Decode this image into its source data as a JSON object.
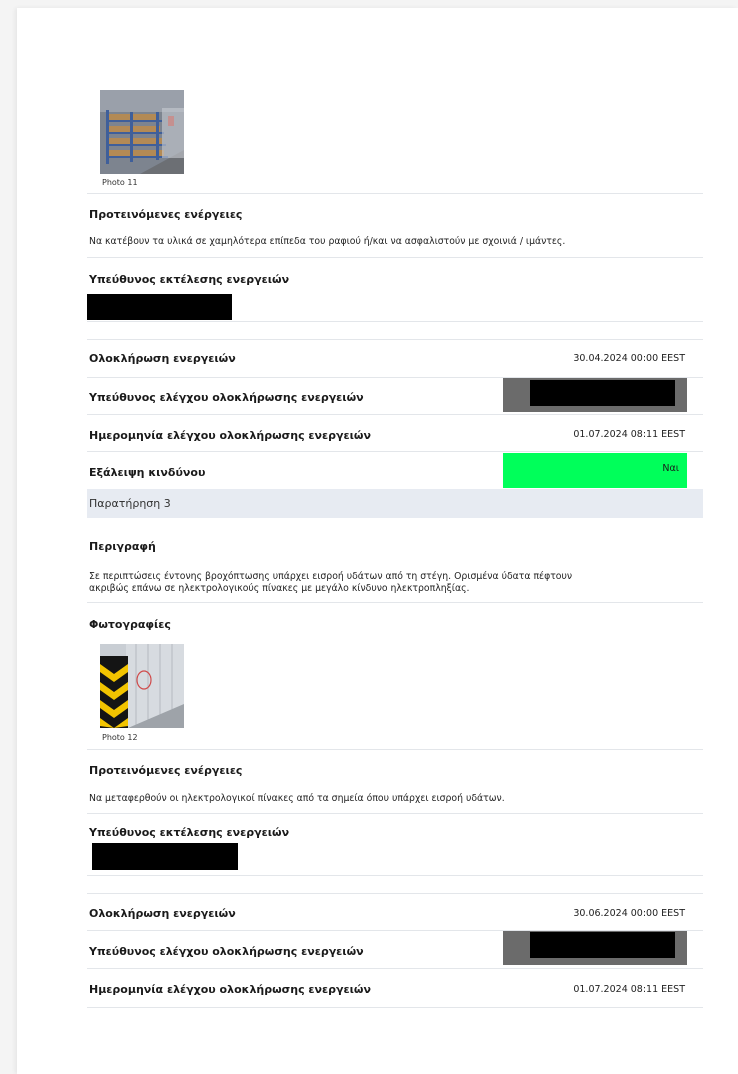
{
  "observation_2": {
    "photo": {
      "caption": "Photo 11"
    },
    "proposed_actions": {
      "label": "Προτεινόμενες ενέργειες",
      "text": "Να κατέβουν τα υλικά σε χαμηλότερα επίπεδα του ραφιού ή/και να ασφαλιστούν με σχοινιά / ιμάντες."
    },
    "executor": {
      "label": "Υπεύθυνος εκτέλεσης ενεργειών"
    },
    "completion": {
      "label": "Ολοκλήρωση ενεργειών",
      "value": "30.04.2024 00:00 EEST"
    },
    "checker": {
      "label": "Υπεύθυνος ελέγχου ολοκλήρωσης ενεργειών"
    },
    "check_date": {
      "label": "Ημερομηνία ελέγχου ολοκλήρωσης ενεργειών",
      "value": "01.07.2024 08:11 EEST"
    },
    "hazard_removed": {
      "label": "Εξάλειψη κινδύνου",
      "value": "Ναι"
    }
  },
  "observation_3": {
    "title": "Παρατήρηση 3",
    "description": {
      "label": "Περιγραφή",
      "line1": "Σε περιπτώσεις έντονης βροχόπτωσης υπάρχει εισροή υδάτων από τη στέγη. Ορισμένα ύδατα πέφτουν",
      "line2": "ακριβώς επάνω σε ηλεκτρολογικούς πίνακες με μεγάλο κίνδυνο ηλεκτροπληξίας."
    },
    "photos": {
      "label": "Φωτογραφίες",
      "caption": "Photo 12"
    },
    "proposed_actions": {
      "label": "Προτεινόμενες ενέργειες",
      "text": "Να μεταφερθούν οι ηλεκτρολογικοί πίνακες από τα σημεία όπου υπάρχει εισροή υδάτων."
    },
    "executor": {
      "label": "Υπεύθυνος εκτέλεσης ενεργειών"
    },
    "completion": {
      "label": "Ολοκλήρωση ενεργειών",
      "value": "30.06.2024 00:00 EEST"
    },
    "checker": {
      "label": "Υπεύθυνος ελέγχου ολοκλήρωσης ενεργειών"
    },
    "check_date": {
      "label": "Ημερομηνία ελέγχου ολοκλήρωσης ενεργειών",
      "value": "01.07.2024 08:11 EEST"
    }
  },
  "colors": {
    "hazard_removed_bg": "#00ff5a",
    "checker_bg": "#6b6b6b",
    "section_band_bg": "#e7ebf2",
    "separator": "#e3e6ea"
  }
}
